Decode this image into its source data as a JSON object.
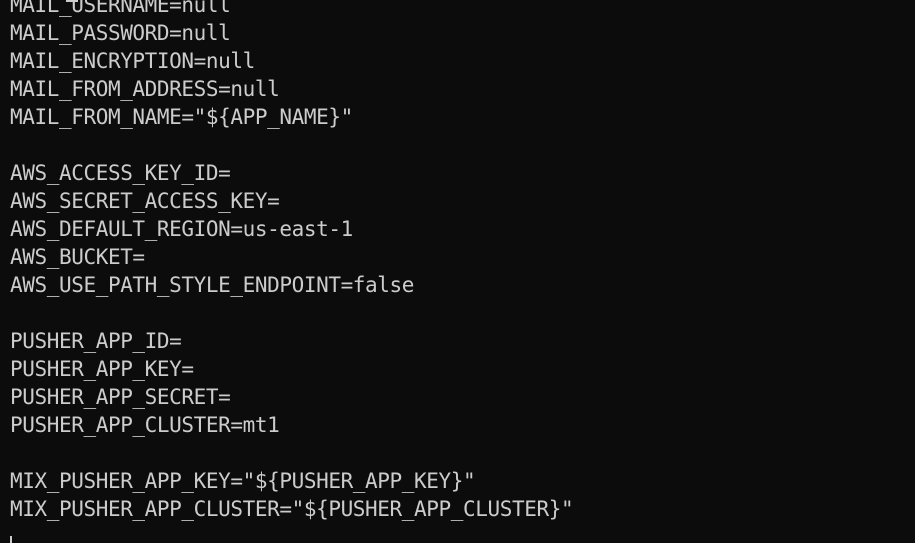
{
  "terminal": {
    "lines": [
      "MAIL_USERNAME=null",
      "MAIL_PASSWORD=null",
      "MAIL_ENCRYPTION=null",
      "MAIL_FROM_ADDRESS=null",
      "MAIL_FROM_NAME=\"${APP_NAME}\"",
      "",
      "AWS_ACCESS_KEY_ID=",
      "AWS_SECRET_ACCESS_KEY=",
      "AWS_DEFAULT_REGION=us-east-1",
      "AWS_BUCKET=",
      "AWS_USE_PATH_STYLE_ENDPOINT=false",
      "",
      "PUSHER_APP_ID=",
      "PUSHER_APP_KEY=",
      "PUSHER_APP_SECRET=",
      "PUSHER_APP_CLUSTER=mt1",
      "",
      "MIX_PUSHER_APP_KEY=\"${PUSHER_APP_KEY}\"",
      "MIX_PUSHER_APP_CLUSTER=\"${PUSHER_APP_CLUSTER}\""
    ],
    "colors": {
      "background": "#0c0c0c",
      "foreground": "#cccccc"
    }
  }
}
